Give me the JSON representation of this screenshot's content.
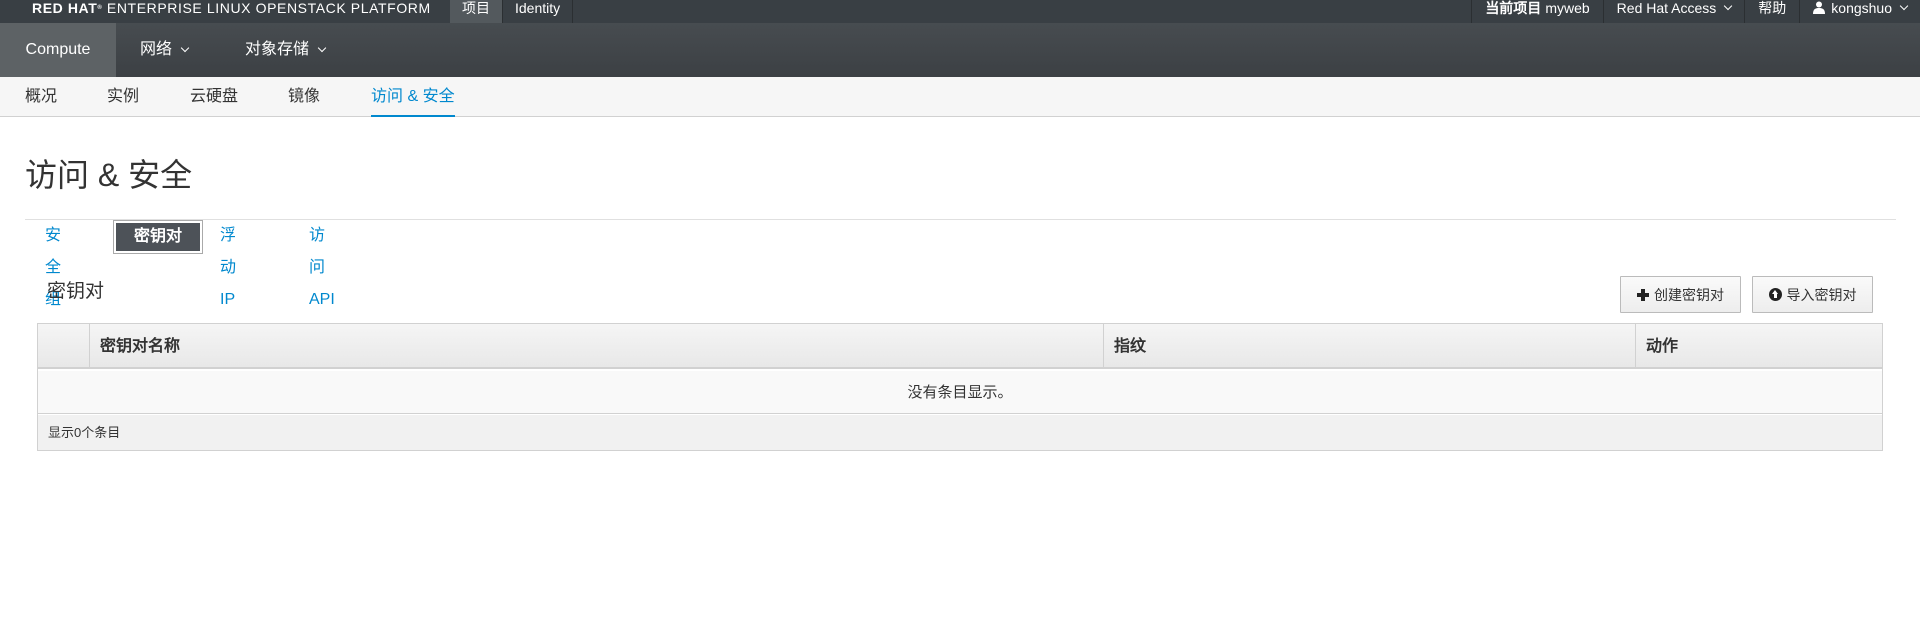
{
  "topbar": {
    "brand_bold": "RED HAT",
    "brand_reg": "®",
    "brand_rest": " ENTERPRISE LINUX OPENSTACK PLATFORM",
    "nav": [
      "项目",
      "Identity"
    ],
    "project_label": "当前项目",
    "project_value": "myweb",
    "access": "Red Hat Access",
    "help": "帮助",
    "user": "kongshuo",
    "user_icon": "user-icon"
  },
  "secondary_nav": [
    "Compute",
    "网络",
    "对象存储"
  ],
  "tertiary_nav": [
    "概况",
    "实例",
    "云硬盘",
    "镜像",
    "访问 & 安全"
  ],
  "page": {
    "title": "访问 & 安全",
    "tabs": [
      "安全组",
      "密钥对",
      "浮动IP",
      "访问API"
    ],
    "section_title": "密钥对",
    "buttons": {
      "create": "创建密钥对",
      "import": "导入密钥对"
    },
    "table": {
      "headers": [
        "密钥对名称",
        "指纹",
        "动作"
      ],
      "empty": "没有条目显示。",
      "footer": "显示0个条目"
    }
  },
  "colors": {
    "topbar": "#393f44",
    "secbar": "#474c50",
    "link": "#0088ce",
    "active_tab": "#4d5258"
  }
}
